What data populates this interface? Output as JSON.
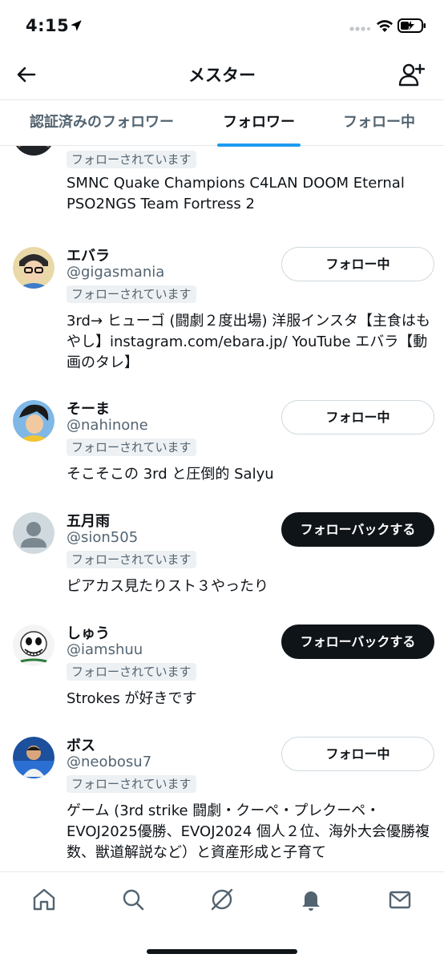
{
  "status_bar": {
    "time": "4:15"
  },
  "header": {
    "title": "メスター"
  },
  "tabs": [
    {
      "label": "認証済みのフォロワー",
      "active": false
    },
    {
      "label": "フォロワー",
      "active": true
    },
    {
      "label": "フォロー中",
      "active": false
    }
  ],
  "colors": {
    "accent": "#1d9bf0",
    "text_primary": "#0f1419",
    "text_secondary": "#536471",
    "badge_bg": "#eef1f3"
  },
  "users": [
    {
      "name": "",
      "handle": "",
      "badge": "フォローされています",
      "bio": "SMNC Quake Champions C4LAN DOOM Eternal PSO2NGS Team Fortress 2",
      "button": ""
    },
    {
      "name": "エバラ",
      "handle": "@gigasmania",
      "badge": "フォローされています",
      "bio": "3rd→ ヒューゴ (闘劇２度出場) 洋服インスタ【主食はもやし】instagram.com/ebara.jp/ YouTube エバラ【動画のタレ】",
      "button": "フォロー中"
    },
    {
      "name": "そーま",
      "handle": "@nahinone",
      "badge": "フォローされています",
      "bio": "そこそこの 3rd と圧倒的 Salyu",
      "button": "フォロー中"
    },
    {
      "name": "五月雨",
      "handle": "@sion505",
      "badge": "フォローされています",
      "bio": "ピアカス見たりスト３やったり",
      "button": "フォローバックする"
    },
    {
      "name": "しゅう",
      "handle": "@iamshuu",
      "badge": "フォローされています",
      "bio": "Strokes が好きです",
      "button": "フォローバックする"
    },
    {
      "name": "ボス",
      "handle": "@neobosu7",
      "badge": "フォローされています",
      "bio": "ゲーム (3rd strike 闘劇・クーペ・プレクーペ・EVOJ2025優勝、EVOJ2024 個人２位、海外大会優勝複数、獣道解説など）と資産形成と子育て",
      "button": "フォロー中"
    }
  ],
  "bottom_nav": {
    "icons": [
      "home-icon",
      "search-icon",
      "grok-icon",
      "notifications-icon",
      "messages-icon"
    ]
  }
}
